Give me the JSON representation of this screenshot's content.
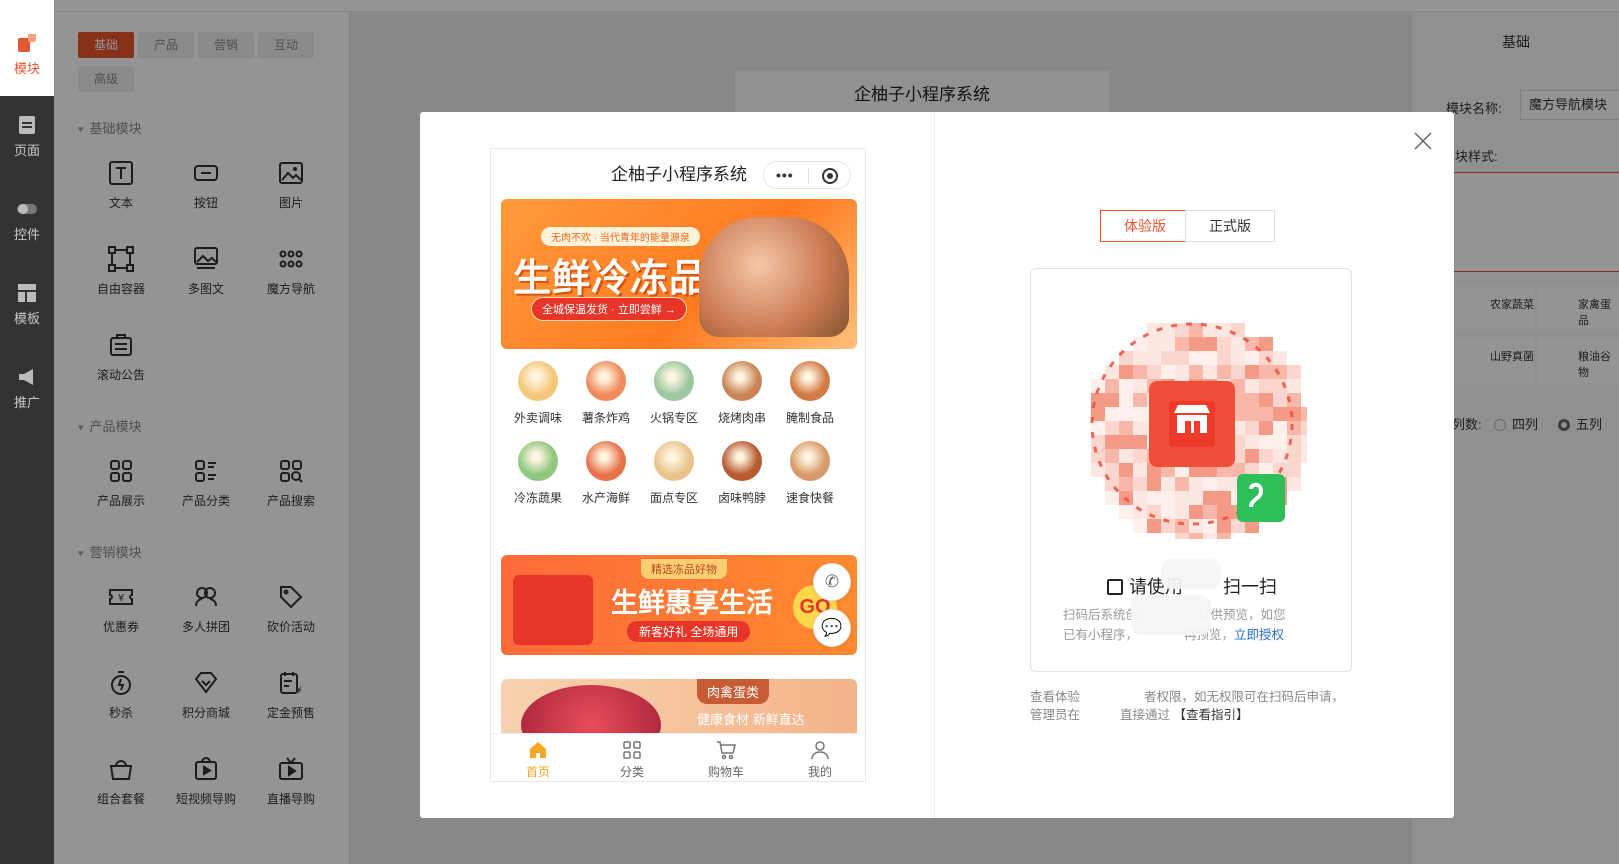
{
  "left_nav": {
    "items": [
      {
        "label": "模块",
        "icon": "blocks-icon",
        "active": true
      },
      {
        "label": "页面",
        "icon": "page-icon",
        "active": false
      },
      {
        "label": "控件",
        "icon": "toggle-icon",
        "active": false
      },
      {
        "label": "模板",
        "icon": "template-icon",
        "active": false
      },
      {
        "label": "推广",
        "icon": "megaphone-icon",
        "active": false
      }
    ]
  },
  "panel": {
    "tabs": [
      "基础",
      "产品",
      "营销",
      "互动",
      "高级"
    ],
    "active_tab": "基础",
    "sections": [
      {
        "title": "基础模块",
        "items": [
          "文本",
          "按钮",
          "图片",
          "自由容器",
          "多图文",
          "魔方导航",
          "滚动公告"
        ]
      },
      {
        "title": "产品模块",
        "items": [
          "产品展示",
          "产品分类",
          "产品搜索"
        ]
      },
      {
        "title": "营销模块",
        "items": [
          "优惠券",
          "多人拼团",
          "砍价活动",
          "秒杀",
          "积分商城",
          "定金预售",
          "组合套餐",
          "短视频导购",
          "直播导购"
        ]
      }
    ]
  },
  "canvas": {
    "title": "企柚子小程序系统"
  },
  "right_panel": {
    "header": "基础",
    "module_name_label": "模块名称:",
    "module_name_value": "魔方导航模块",
    "module_style_label": "模块样式:",
    "columns_label": "列数:",
    "column_options": [
      "四列",
      "五列"
    ],
    "selected_column": "五列",
    "style_tiles": [
      "农家蔬菜",
      "家禽蛋品",
      "山野真菌",
      "粮油谷物"
    ]
  },
  "modal": {
    "phone": {
      "title": "企柚子小程序系统",
      "banner1": {
        "pill": "无肉不欢 · 当代青年的能量源泉",
        "headline": "生鲜冷冻品",
        "cta": "全城保温发货 · 立即尝鲜 →"
      },
      "categories": [
        {
          "label": "外卖调味",
          "color": "#f4c67a"
        },
        {
          "label": "薯条炸鸡",
          "color": "#f08a5b"
        },
        {
          "label": "火锅专区",
          "color": "#9dc7a0"
        },
        {
          "label": "烧烤肉串",
          "color": "#c98456"
        },
        {
          "label": "腌制食品",
          "color": "#d07a45"
        },
        {
          "label": "冷冻蔬果",
          "color": "#8ec77d"
        },
        {
          "label": "水产海鲜",
          "color": "#e8724a"
        },
        {
          "label": "面点专区",
          "color": "#e8c48c"
        },
        {
          "label": "卤味鸭脖",
          "color": "#b85a30"
        },
        {
          "label": "速食快餐",
          "color": "#d89a6a"
        }
      ],
      "banner2": {
        "tag": "精选冻品好物",
        "headline": "生鲜惠享生活",
        "sub": "新客好礼 全场通用",
        "go": "GO"
      },
      "banner3": {
        "tag": "肉禽蛋类",
        "sub": "健康食材 新鲜直达"
      },
      "tabbar": [
        {
          "label": "首页",
          "active": true
        },
        {
          "label": "分类",
          "active": false
        },
        {
          "label": "购物车",
          "active": false
        },
        {
          "label": "我的",
          "active": false
        }
      ]
    },
    "version_tabs": [
      "体验版",
      "正式版"
    ],
    "active_version": "体验版",
    "scan_title": "请使用",
    "scan_title_tail": "扫一扫",
    "scan_desc_1": "扫码后系统创",
    "scan_desc_2": "以供预览，如您",
    "scan_desc_3": "已有小程序，",
    "scan_desc_4": "再预览，",
    "scan_link": "立即授权",
    "note_1": "查看体验",
    "note_2": "者权限，如无权限可在扫码后申请，",
    "note_3": "管理员在",
    "note_4": "直接通过",
    "note_link": "【查看指引】"
  },
  "colors": {
    "accent": "#e8552f",
    "tab_active": "#f5a623",
    "link": "#2a6bd8"
  }
}
